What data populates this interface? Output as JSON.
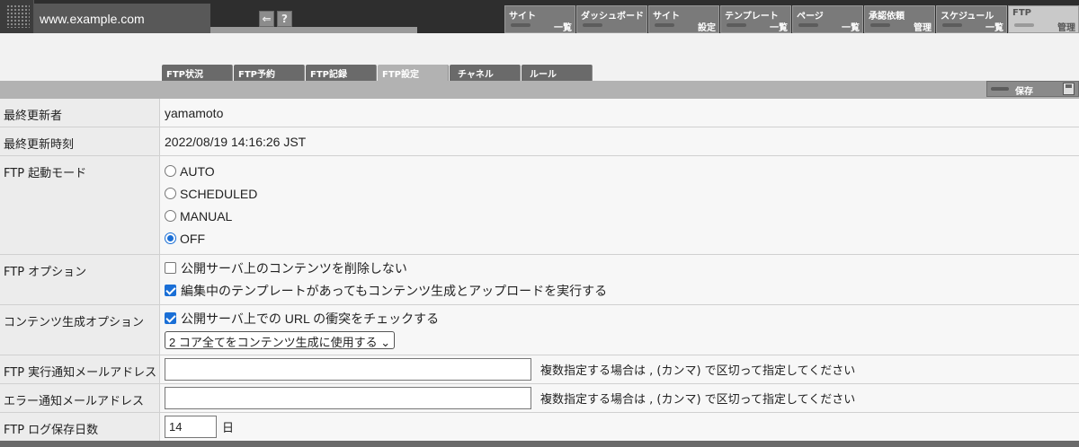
{
  "header": {
    "site_name": "www.example.com",
    "back_icon": "back-arrow-icon",
    "help_label": "?"
  },
  "menus": [
    {
      "top": "サイト",
      "bottom": "一覧"
    },
    {
      "top": "ダッシュボード",
      "bottom": ""
    },
    {
      "top": "サイト",
      "bottom": "設定"
    },
    {
      "top": "テンプレート",
      "bottom": "一覧"
    },
    {
      "top": "ページ",
      "bottom": "一覧"
    },
    {
      "top": "承認依頼",
      "bottom": "管理"
    },
    {
      "top": "スケジュール",
      "bottom": "一覧"
    },
    {
      "top": "FTP",
      "bottom": "管理"
    }
  ],
  "subtabs": [
    "FTP状況",
    "FTP予約",
    "FTP記録",
    "FTP設定",
    "チャネル",
    "ルール"
  ],
  "save_label": "保存",
  "form": {
    "last_updater_label": "最終更新者",
    "last_updater_value": "yamamoto",
    "last_updated_label": "最終更新時刻",
    "last_updated_value": "2022/08/19 14:16:26 JST",
    "mode_label": "FTP 起動モード",
    "mode_options": [
      "AUTO",
      "SCHEDULED",
      "MANUAL",
      "OFF"
    ],
    "mode_selected": "OFF",
    "option_label": "FTP オプション",
    "option_1": "公開サーバ上のコンテンツを削除しない",
    "option_2": "編集中のテンプレートがあってもコンテンツ生成とアップロードを実行する",
    "gen_label": "コンテンツ生成オプション",
    "gen_check": "公開サーバ上での URL の衝突をチェックする",
    "gen_select": "2 コア全てをコンテンツ生成に使用する",
    "exec_mail_label": "FTP 実行通知メールアドレス",
    "exec_mail_value": "",
    "exec_mail_hint": "複数指定する場合は , (カンマ) で区切って指定してください",
    "err_mail_label": "エラー通知メールアドレス",
    "err_mail_value": "",
    "err_mail_hint": "複数指定する場合は , (カンマ) で区切って指定してください",
    "log_label": "FTP ログ保存日数",
    "log_value": "14",
    "log_unit": "日"
  }
}
